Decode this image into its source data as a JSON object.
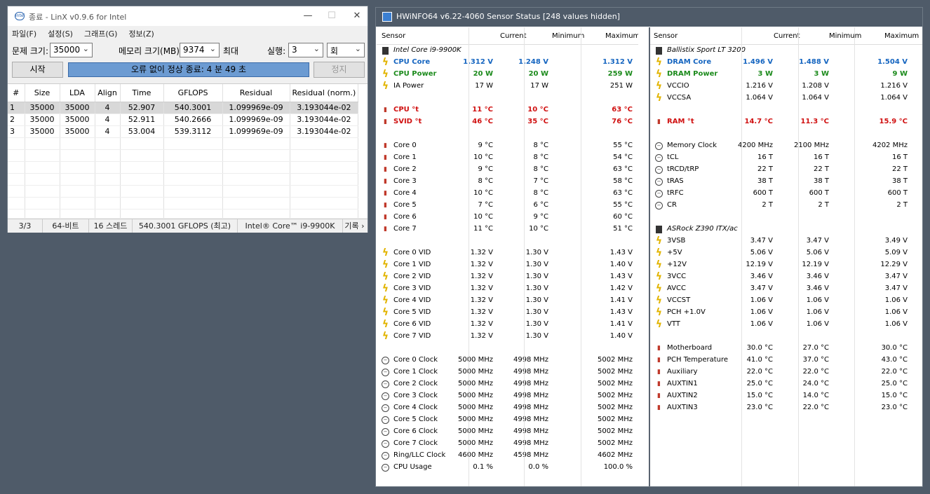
{
  "linx": {
    "title": "종료 - LinX v0.9.6 for Intel",
    "menu": [
      "파일(F)",
      "설정(S)",
      "그래프(G)",
      "정보(Z)"
    ],
    "problem_label": "문제 크기:",
    "problem_value": "35000",
    "memory_label": "메모리 크기(MB):",
    "memory_value": "9374",
    "memory_max": "최대",
    "run_label": "실행:",
    "run_value": "3",
    "run_unit": "회",
    "start_btn": "시작",
    "status": "오류 없이 정상 종료: 4 분 49 초",
    "stop_btn": "정지",
    "columns": [
      "#",
      "Size",
      "LDA",
      "Align",
      "Time",
      "GFLOPS",
      "Residual",
      "Residual (norm.)"
    ],
    "rows": [
      [
        "1",
        "35000",
        "35000",
        "4",
        "52.907",
        "540.3001",
        "1.099969e-09",
        "3.193044e-02"
      ],
      [
        "2",
        "35000",
        "35000",
        "4",
        "52.911",
        "540.2666",
        "1.099969e-09",
        "3.193044e-02"
      ],
      [
        "3",
        "35000",
        "35000",
        "4",
        "53.004",
        "539.3112",
        "1.099969e-09",
        "3.193044e-02"
      ]
    ],
    "statusbar": [
      "3/3",
      "64-비트",
      "16 스레드",
      "540.3001 GFLOPS (최고)",
      "Intel® Core™ i9-9900K",
      "기록 ›"
    ]
  },
  "hw": {
    "title": "HWiNFO64 v6.22-4060 Sensor Status [248 values hidden]",
    "headers": [
      "Sensor",
      "Current",
      "Minimum",
      "Maximum"
    ],
    "left": [
      {
        "t": "grp",
        "l": "Intel Core i9-9900K"
      },
      {
        "t": "bolt",
        "l": "CPU Core",
        "c": "1.312 V",
        "n": "1.248 V",
        "x": "1.312 V",
        "s": "blue"
      },
      {
        "t": "bolt",
        "l": "CPU Power",
        "c": "20 W",
        "n": "20 W",
        "x": "259 W",
        "s": "green"
      },
      {
        "t": "bolt",
        "l": "IA Power",
        "c": "17 W",
        "n": "17 W",
        "x": "251 W"
      },
      {
        "t": "gap"
      },
      {
        "t": "therm",
        "l": "CPU °t",
        "c": "11 °C",
        "n": "10 °C",
        "x": "63 °C",
        "s": "red"
      },
      {
        "t": "therm",
        "l": "SVID °t",
        "c": "46 °C",
        "n": "35 °C",
        "x": "76 °C",
        "s": "red"
      },
      {
        "t": "gap"
      },
      {
        "t": "therm",
        "l": "Core 0",
        "c": "9 °C",
        "n": "8 °C",
        "x": "55 °C"
      },
      {
        "t": "therm",
        "l": "Core 1",
        "c": "10 °C",
        "n": "8 °C",
        "x": "54 °C"
      },
      {
        "t": "therm",
        "l": "Core 2",
        "c": "9 °C",
        "n": "8 °C",
        "x": "63 °C"
      },
      {
        "t": "therm",
        "l": "Core 3",
        "c": "8 °C",
        "n": "7 °C",
        "x": "58 °C"
      },
      {
        "t": "therm",
        "l": "Core 4",
        "c": "10 °C",
        "n": "8 °C",
        "x": "63 °C"
      },
      {
        "t": "therm",
        "l": "Core 5",
        "c": "7 °C",
        "n": "6 °C",
        "x": "55 °C"
      },
      {
        "t": "therm",
        "l": "Core 6",
        "c": "10 °C",
        "n": "9 °C",
        "x": "60 °C"
      },
      {
        "t": "therm",
        "l": "Core 7",
        "c": "11 °C",
        "n": "10 °C",
        "x": "51 °C"
      },
      {
        "t": "gap"
      },
      {
        "t": "bolt",
        "l": "Core 0 VID",
        "c": "1.32 V",
        "n": "1.30 V",
        "x": "1.43 V"
      },
      {
        "t": "bolt",
        "l": "Core 1 VID",
        "c": "1.32 V",
        "n": "1.30 V",
        "x": "1.40 V"
      },
      {
        "t": "bolt",
        "l": "Core 2 VID",
        "c": "1.32 V",
        "n": "1.30 V",
        "x": "1.43 V"
      },
      {
        "t": "bolt",
        "l": "Core 3 VID",
        "c": "1.32 V",
        "n": "1.30 V",
        "x": "1.42 V"
      },
      {
        "t": "bolt",
        "l": "Core 4 VID",
        "c": "1.32 V",
        "n": "1.30 V",
        "x": "1.41 V"
      },
      {
        "t": "bolt",
        "l": "Core 5 VID",
        "c": "1.32 V",
        "n": "1.30 V",
        "x": "1.43 V"
      },
      {
        "t": "bolt",
        "l": "Core 6 VID",
        "c": "1.32 V",
        "n": "1.30 V",
        "x": "1.41 V"
      },
      {
        "t": "bolt",
        "l": "Core 7 VID",
        "c": "1.32 V",
        "n": "1.30 V",
        "x": "1.40 V"
      },
      {
        "t": "gap"
      },
      {
        "t": "clk",
        "l": "Core 0 Clock",
        "c": "5000 MHz",
        "n": "4998 MHz",
        "x": "5002 MHz"
      },
      {
        "t": "clk",
        "l": "Core 1 Clock",
        "c": "5000 MHz",
        "n": "4998 MHz",
        "x": "5002 MHz"
      },
      {
        "t": "clk",
        "l": "Core 2 Clock",
        "c": "5000 MHz",
        "n": "4998 MHz",
        "x": "5002 MHz"
      },
      {
        "t": "clk",
        "l": "Core 3 Clock",
        "c": "5000 MHz",
        "n": "4998 MHz",
        "x": "5002 MHz"
      },
      {
        "t": "clk",
        "l": "Core 4 Clock",
        "c": "5000 MHz",
        "n": "4998 MHz",
        "x": "5002 MHz"
      },
      {
        "t": "clk",
        "l": "Core 5 Clock",
        "c": "5000 MHz",
        "n": "4998 MHz",
        "x": "5002 MHz"
      },
      {
        "t": "clk",
        "l": "Core 6 Clock",
        "c": "5000 MHz",
        "n": "4998 MHz",
        "x": "5002 MHz"
      },
      {
        "t": "clk",
        "l": "Core 7 Clock",
        "c": "5000 MHz",
        "n": "4998 MHz",
        "x": "5002 MHz"
      },
      {
        "t": "clk",
        "l": "Ring/LLC Clock",
        "c": "4600 MHz",
        "n": "4598 MHz",
        "x": "4602 MHz"
      },
      {
        "t": "clk",
        "l": "CPU Usage",
        "c": "0.1 %",
        "n": "0.0 %",
        "x": "100.0 %"
      }
    ],
    "right": [
      {
        "t": "grp",
        "l": "Ballistix Sport LT 3200"
      },
      {
        "t": "bolt",
        "l": "DRAM Core",
        "c": "1.496 V",
        "n": "1.488 V",
        "x": "1.504 V",
        "s": "blue"
      },
      {
        "t": "bolt",
        "l": "DRAM Power",
        "c": "3 W",
        "n": "3 W",
        "x": "9 W",
        "s": "green"
      },
      {
        "t": "bolt",
        "l": "VCCIO",
        "c": "1.216 V",
        "n": "1.208 V",
        "x": "1.216 V"
      },
      {
        "t": "bolt",
        "l": "VCCSA",
        "c": "1.064 V",
        "n": "1.064 V",
        "x": "1.064 V"
      },
      {
        "t": "gap"
      },
      {
        "t": "therm",
        "l": "RAM °t",
        "c": "14.7 °C",
        "n": "11.3 °C",
        "x": "15.9 °C",
        "s": "red"
      },
      {
        "t": "gap"
      },
      {
        "t": "clk",
        "l": "Memory Clock",
        "c": "4200 MHz",
        "n": "2100 MHz",
        "x": "4202 MHz"
      },
      {
        "t": "clk",
        "l": "tCL",
        "c": "16 T",
        "n": "16 T",
        "x": "16 T"
      },
      {
        "t": "clk",
        "l": "tRCD/tRP",
        "c": "22 T",
        "n": "22 T",
        "x": "22 T"
      },
      {
        "t": "clk",
        "l": "tRAS",
        "c": "38 T",
        "n": "38 T",
        "x": "38 T"
      },
      {
        "t": "clk",
        "l": "tRFC",
        "c": "600 T",
        "n": "600 T",
        "x": "600 T"
      },
      {
        "t": "clk",
        "l": "CR",
        "c": "2 T",
        "n": "2 T",
        "x": "2 T"
      },
      {
        "t": "gap"
      },
      {
        "t": "grp",
        "l": "ASRock Z390 ITX/ac"
      },
      {
        "t": "bolt",
        "l": "3VSB",
        "c": "3.47 V",
        "n": "3.47 V",
        "x": "3.49 V"
      },
      {
        "t": "bolt",
        "l": "+5V",
        "c": "5.06 V",
        "n": "5.06 V",
        "x": "5.09 V"
      },
      {
        "t": "bolt",
        "l": "+12V",
        "c": "12.19 V",
        "n": "12.19 V",
        "x": "12.29 V"
      },
      {
        "t": "bolt",
        "l": "3VCC",
        "c": "3.46 V",
        "n": "3.46 V",
        "x": "3.47 V"
      },
      {
        "t": "bolt",
        "l": "AVCC",
        "c": "3.47 V",
        "n": "3.46 V",
        "x": "3.47 V"
      },
      {
        "t": "bolt",
        "l": "VCCST",
        "c": "1.06 V",
        "n": "1.06 V",
        "x": "1.06 V"
      },
      {
        "t": "bolt",
        "l": "PCH +1.0V",
        "c": "1.06 V",
        "n": "1.06 V",
        "x": "1.06 V"
      },
      {
        "t": "bolt",
        "l": "VTT",
        "c": "1.06 V",
        "n": "1.06 V",
        "x": "1.06 V"
      },
      {
        "t": "gap"
      },
      {
        "t": "therm",
        "l": "Motherboard",
        "c": "30.0 °C",
        "n": "27.0 °C",
        "x": "30.0 °C"
      },
      {
        "t": "therm",
        "l": "PCH Temperature",
        "c": "41.0 °C",
        "n": "37.0 °C",
        "x": "43.0 °C"
      },
      {
        "t": "therm",
        "l": "Auxiliary",
        "c": "22.0 °C",
        "n": "22.0 °C",
        "x": "22.0 °C"
      },
      {
        "t": "therm",
        "l": "AUXTIN1",
        "c": "25.0 °C",
        "n": "24.0 °C",
        "x": "25.0 °C"
      },
      {
        "t": "therm",
        "l": "AUXTIN2",
        "c": "15.0 °C",
        "n": "14.0 °C",
        "x": "15.0 °C"
      },
      {
        "t": "therm",
        "l": "AUXTIN3",
        "c": "23.0 °C",
        "n": "22.0 °C",
        "x": "23.0 °C"
      }
    ]
  }
}
